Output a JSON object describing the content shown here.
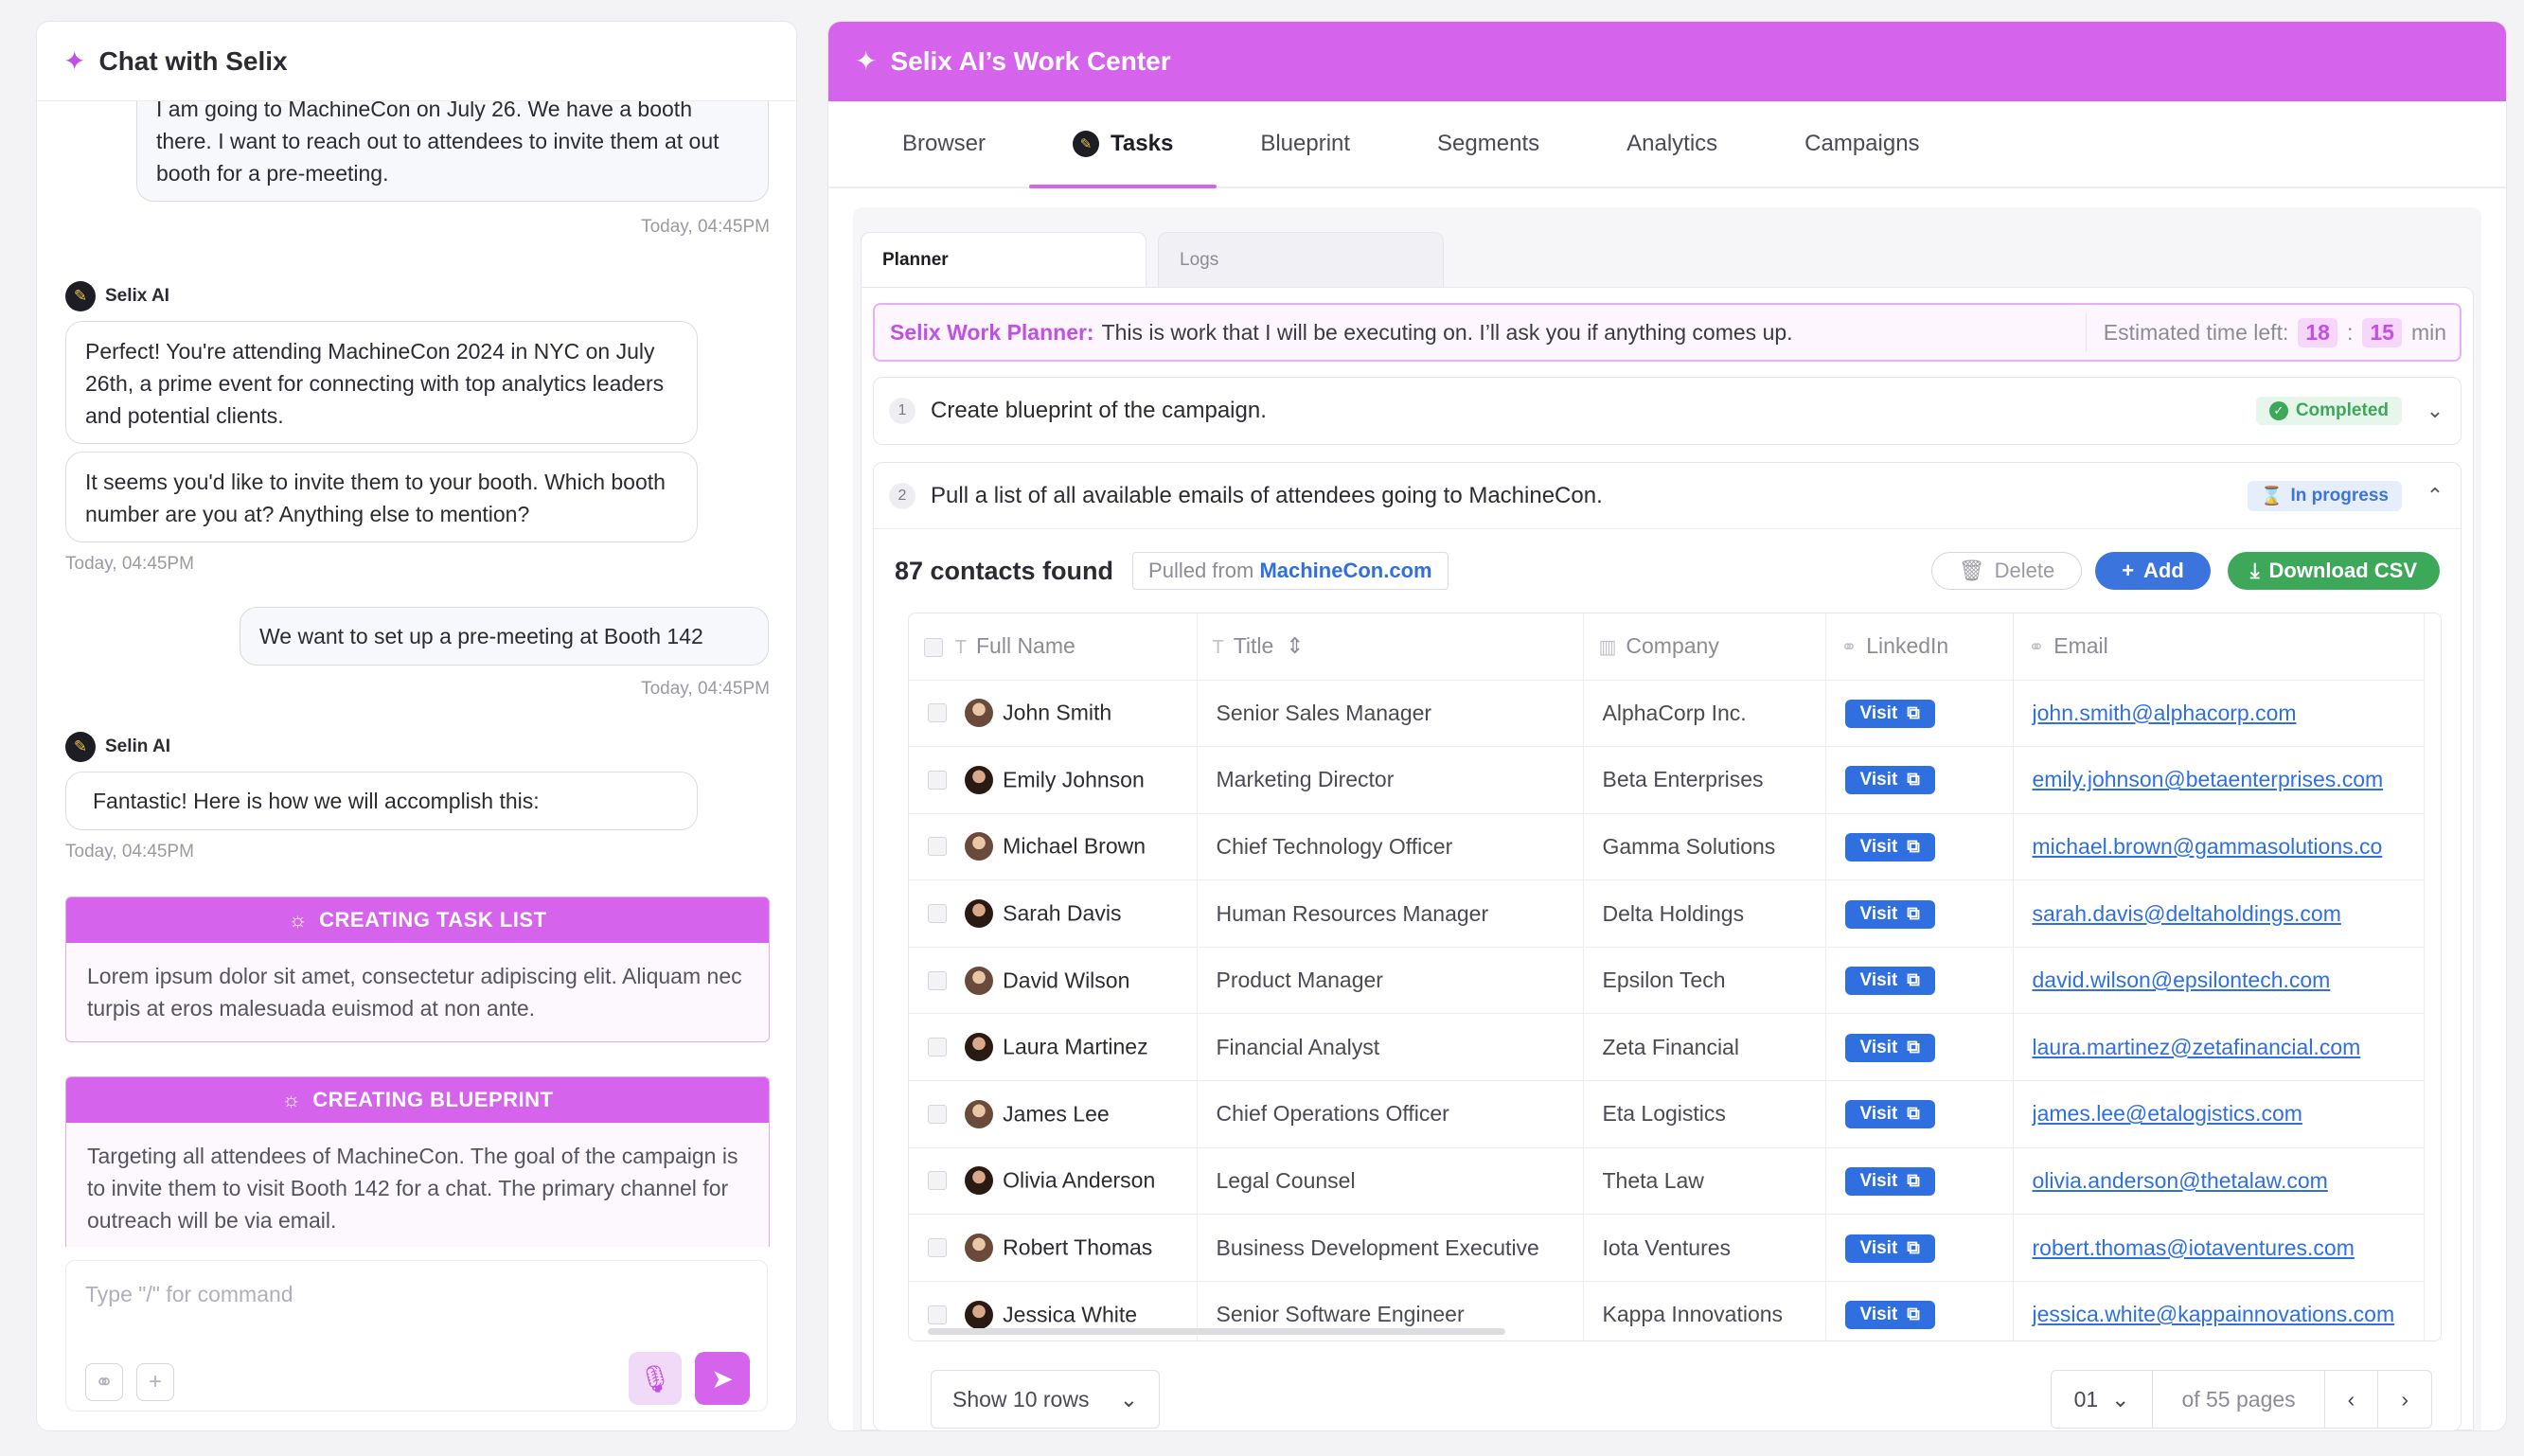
{
  "chat": {
    "title": "Chat with Selix",
    "messages": {
      "m1": "I am going to MachineCon on July 26. We have a booth there. I want to reach out to attendees to invite them at out booth for a pre-meeting.",
      "m1_ts": "Today, 04:45PM",
      "sender1": "Selix AI",
      "m2": "Perfect! You're attending MachineCon 2024 in NYC on July 26th, a prime event for connecting with top analytics leaders and potential clients.",
      "m3": "It seems you'd like to invite them to your booth. Which booth number are you at? Anything else to mention?",
      "m3_ts": "Today, 04:45PM",
      "m4": "We want to set up a pre-meeting at Booth 142",
      "m4_ts": "Today, 04:45PM",
      "sender2": "Selin AI",
      "m5": "Fantastic! Here is how we will accomplish this:",
      "m5_ts": "Today, 04:45PM"
    },
    "cards": {
      "task_title": "CREATING TASK LIST",
      "task_body": "Lorem ipsum dolor sit amet, consectetur adipiscing elit. Aliquam nec turpis at eros malesuada euismod at non ante.",
      "blueprint_title": "CREATING BLUEPRINT",
      "blueprint_body": "Targeting all attendees of MachineCon. The goal of the campaign is to invite them to visit Booth 142 for a chat. The primary channel for outreach will be via email."
    },
    "composer": {
      "placeholder": "Type \"/\" for command"
    }
  },
  "work": {
    "title": "Selix AI’s Work Center",
    "tabs": [
      "Browser",
      "Tasks",
      "Blueprint",
      "Segments",
      "Analytics",
      "Campaigns"
    ],
    "active_tab": "Tasks",
    "subtabs": [
      "Planner",
      "Logs"
    ],
    "banner": {
      "label": "Selix Work Planner:",
      "text": "This is work that I will be executing on. I’ll ask you if anything comes up.",
      "eta_label": "Estimated time left:",
      "eta_h": "18",
      "eta_sep": ":",
      "eta_m": "15",
      "eta_unit": "min"
    },
    "steps": [
      {
        "num": "1",
        "text": "Create blueprint of the campaign.",
        "status": "Completed"
      },
      {
        "num": "2",
        "text": "Pull a list of all available emails of attendees going to MachineCon.",
        "status": "In progress"
      }
    ],
    "contacts": {
      "count": "87 contacts found",
      "source_prefix": "Pulled from",
      "source_link": "MachineCon.com",
      "delete": "Delete",
      "add": "Add",
      "download": "Download CSV",
      "columns": [
        "Full Name",
        "Title",
        "Company",
        "LinkedIn",
        "Email"
      ],
      "visit_label": "Visit",
      "rows": [
        {
          "name": "John Smith",
          "title": "Senior Sales Manager",
          "company": "AlphaCorp Inc.",
          "email": "john.smith@alphacorp.com"
        },
        {
          "name": "Emily Johnson",
          "title": "Marketing Director",
          "company": "Beta Enterprises",
          "email": "emily.johnson@betaenterprises.com"
        },
        {
          "name": "Michael Brown",
          "title": "Chief Technology Officer",
          "company": "Gamma Solutions",
          "email": "michael.brown@gammasolutions.co"
        },
        {
          "name": "Sarah Davis",
          "title": "Human Resources Manager",
          "company": "Delta Holdings",
          "email": "sarah.davis@deltaholdings.com"
        },
        {
          "name": "David Wilson",
          "title": "Product Manager",
          "company": "Epsilon Tech",
          "email": "david.wilson@epsilontech.com"
        },
        {
          "name": "Laura Martinez",
          "title": "Financial Analyst",
          "company": "Zeta Financial",
          "email": "laura.martinez@zetafinancial.com"
        },
        {
          "name": "James Lee",
          "title": "Chief Operations Officer",
          "company": "Eta Logistics",
          "email": "james.lee@etalogistics.com"
        },
        {
          "name": "Olivia Anderson",
          "title": "Legal Counsel",
          "company": "Theta Law",
          "email": "olivia.anderson@thetalaw.com"
        },
        {
          "name": "Robert Thomas",
          "title": "Business Development Executive",
          "company": "Iota Ventures",
          "email": "robert.thomas@iotaventures.com"
        },
        {
          "name": "Jessica White",
          "title": "Senior Software Engineer",
          "company": "Kappa Innovations",
          "email": "jessica.white@kappainnovations.com"
        }
      ]
    },
    "pager": {
      "rows_label": "Show 10 rows",
      "page": "01",
      "of_pages": "of 55 pages"
    }
  },
  "colors": {
    "brand": "#d663ec",
    "link": "#2f6fe0",
    "success": "#3ea85a"
  }
}
